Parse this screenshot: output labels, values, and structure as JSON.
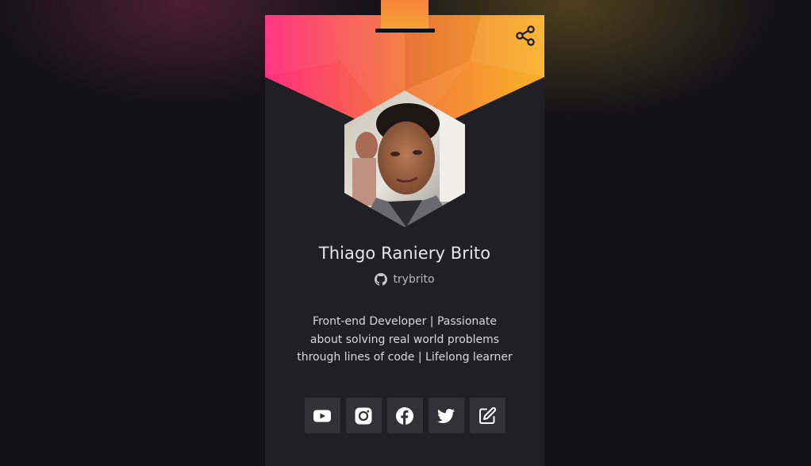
{
  "profile": {
    "name": "Thiago Raniery Brito",
    "github_handle": "trybrito",
    "bio_lines": [
      "Front-end Developer | Passionate",
      "about solving real world problems",
      "through lines of code | Lifelong learner"
    ]
  },
  "icons": {
    "share": "share-icon",
    "github": "github-icon",
    "social": [
      "youtube-icon",
      "instagram-icon",
      "facebook-icon",
      "twitter-icon",
      "edit-icon"
    ]
  },
  "colors": {
    "gradient_start": "#ff2e7e",
    "gradient_mid": "#f4783b",
    "gradient_end": "#f8b227",
    "card_bg": "#201f24",
    "button_bg": "#323136"
  }
}
